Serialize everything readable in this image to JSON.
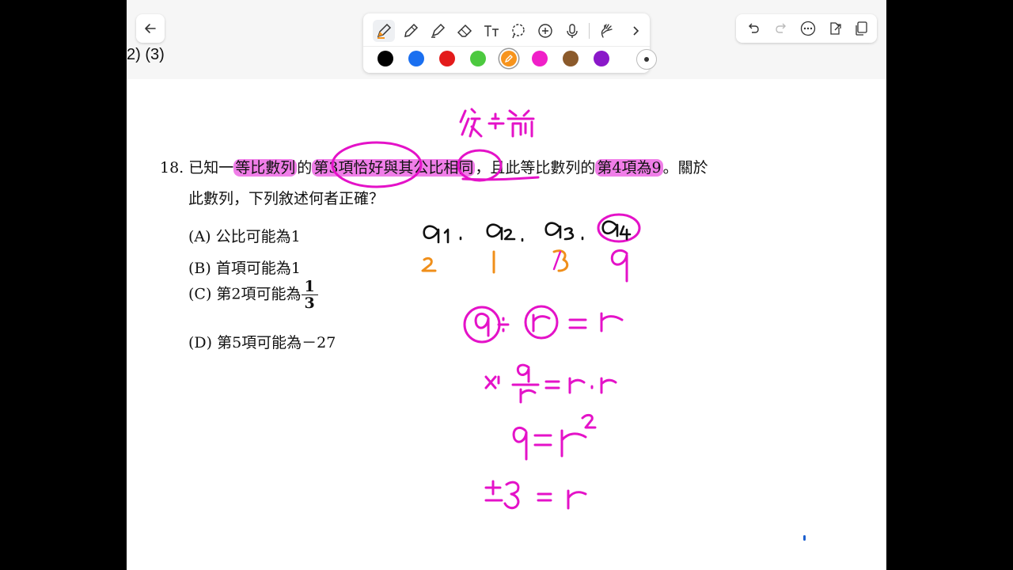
{
  "top": {
    "page_ref": "2) (3)"
  },
  "toolbar": {
    "tools": [
      "pen-icon",
      "pencil-icon",
      "highlighter-icon",
      "eraser-icon",
      "text-icon",
      "lasso-icon",
      "add-icon",
      "microphone-icon",
      "hand-draw-icon",
      "chevron-right-icon"
    ],
    "colors": [
      "#000000",
      "#1a6ff0",
      "#e31b1b",
      "#4cc93f",
      "#f7941d",
      "#f01fc8",
      "#8b5a2b",
      "#8a18c9"
    ],
    "selected_color": "#f7941d"
  },
  "rightbar": {
    "tools": [
      "undo-icon",
      "redo-icon",
      "more-icon",
      "export-icon",
      "pages-icon"
    ]
  },
  "question": {
    "number": "18.",
    "p1": "已知一",
    "h1": "等比數列",
    "p2": "的",
    "h2": "第3項恰好與其公比相同",
    "p3": "，且此等比數列的",
    "h3": "第4項為9",
    "p4": "。關於",
    "line2": "此數列，下列敘述何者正確？",
    "options": {
      "a": "(A) 公比可能為1",
      "b": "(B) 首項可能為1",
      "c_prefix": "(C) 第2項可能為",
      "c_num": "1",
      "c_den": "3",
      "d": "(D) 第5項可能為－27"
    }
  },
  "ink": {
    "pink_color": "#e412c8",
    "orange_color": "#f08f1a",
    "black_color": "#111111"
  }
}
